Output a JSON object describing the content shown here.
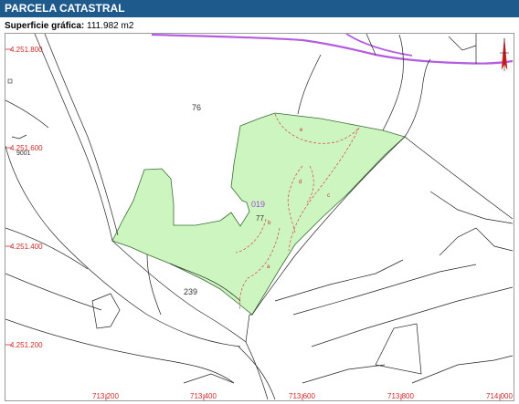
{
  "header": {
    "title": "PARCELA CATASTRAL"
  },
  "area": {
    "label": "Superficie gráfica:",
    "value": "111.982 m2"
  },
  "map": {
    "northings": [
      "4.251.800",
      "4.251.600",
      "4.251.400",
      "4.251.200"
    ],
    "eastings": [
      "713.200",
      "713.400",
      "713.600",
      "713.800",
      "714.000"
    ],
    "parcel_labels": [
      "76",
      "239",
      "77",
      "019",
      "9001"
    ],
    "subparcels": [
      "a",
      "b",
      "c",
      "d",
      "e"
    ],
    "colors": {
      "parcel_fill": "#ccf5c0",
      "parcel_border": "#3a6b33",
      "coord_text": "#cc2a2a",
      "road": "#b55de0",
      "lines": "#222222"
    }
  }
}
